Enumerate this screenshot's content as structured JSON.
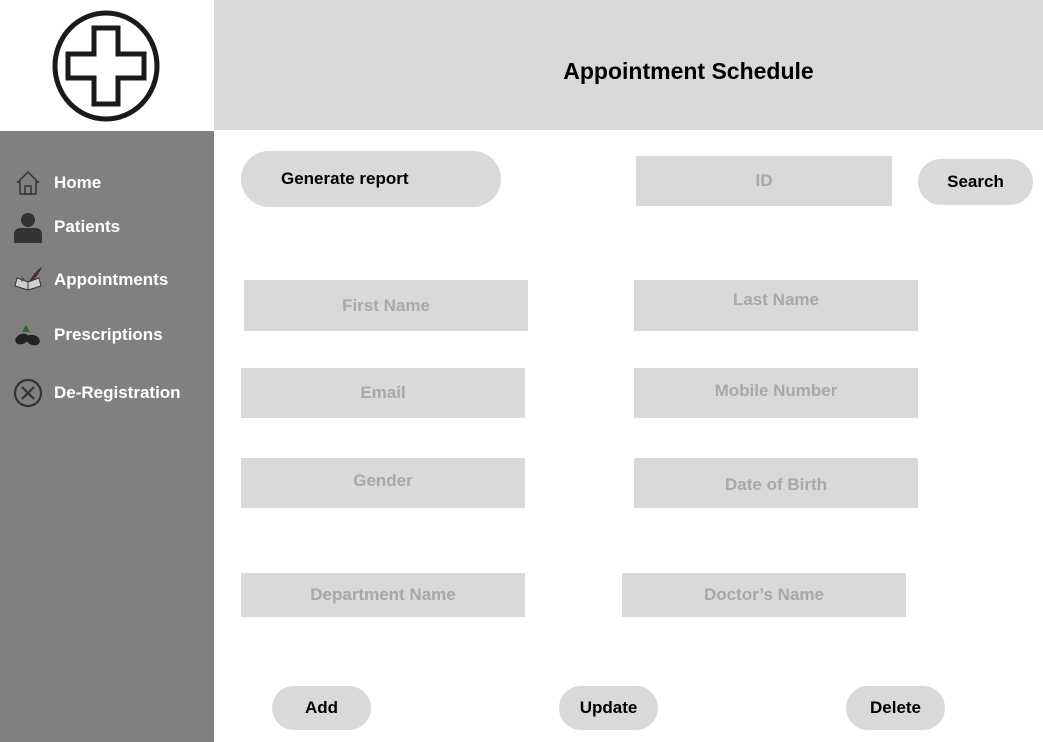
{
  "header": {
    "title": "Appointment Schedule"
  },
  "logo": {
    "icon": "medical-cross-icon"
  },
  "sidebar": {
    "items": [
      {
        "label": "Home",
        "icon": "home-icon"
      },
      {
        "label": "Patients",
        "icon": "person-icon"
      },
      {
        "label": "Appointments",
        "icon": "book-quill-icon"
      },
      {
        "label": "Prescriptions",
        "icon": "pills-icon"
      },
      {
        "label": "De-Registration",
        "icon": "circle-x-icon"
      }
    ]
  },
  "toolbar": {
    "generate_report_label": "Generate report",
    "search_label": "Search",
    "id_placeholder": "ID"
  },
  "form": {
    "first_name_placeholder": "First Name",
    "last_name_placeholder": "Last Name",
    "email_placeholder": "Email",
    "mobile_placeholder": "Mobile Number",
    "gender_placeholder": "Gender",
    "dob_placeholder": "Date of Birth",
    "department_placeholder": "Department Name",
    "doctor_placeholder": "Doctor’s Name"
  },
  "actions": {
    "add_label": "Add",
    "update_label": "Update",
    "delete_label": "Delete"
  },
  "colors": {
    "sidebar_bg": "#808080",
    "header_bg": "#d9d9d9",
    "field_bg": "#d9d9d9",
    "placeholder_text": "#a8a8a8"
  }
}
